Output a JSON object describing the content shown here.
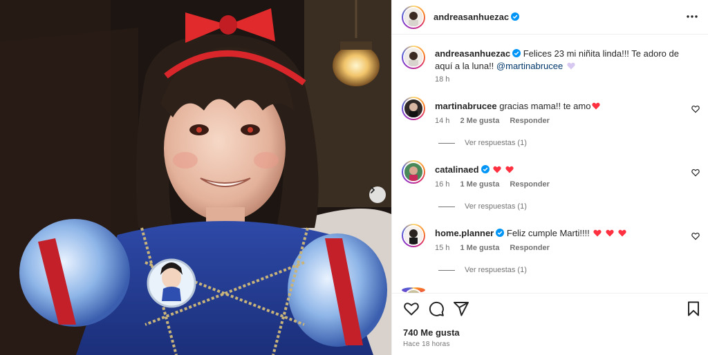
{
  "post": {
    "author": "andreasanhuezac",
    "more_icon": "more-horizontal-icon",
    "caption_user": "andreasanhuezac",
    "caption_text": "Felices 23 mi niñita linda!!! Te adoro de aquí a la luna!!",
    "caption_mention": "@martinabrucee",
    "caption_emoji": "purple-heart",
    "caption_time": "18 h",
    "likes": "740 Me gusta",
    "time_ago": "Hace 18 horas",
    "photo_next_icon": "chevron-right-icon"
  },
  "comments": [
    {
      "user": "martinabrucee",
      "verified": false,
      "text": "gracias mama!! te amo",
      "emoji": "heart",
      "time": "14 h",
      "likes": "2 Me gusta",
      "reply": "Responder",
      "view_replies": "Ver respuestas (1)"
    },
    {
      "user": "catalinaed",
      "verified": true,
      "text": "",
      "emoji": "heart heart",
      "time": "16 h",
      "likes": "1 Me gusta",
      "reply": "Responder",
      "view_replies": "Ver respuestas (1)"
    },
    {
      "user": "home.planner",
      "verified": true,
      "text": "Feliz cumple Marti!!!!",
      "emoji": "heart heart heart",
      "time": "15 h",
      "likes": "1 Me gusta",
      "reply": "Responder",
      "view_replies": "Ver respuestas (1)"
    }
  ],
  "icons": {
    "like": "heart-icon",
    "comment": "comment-icon",
    "share": "share-icon",
    "save": "bookmark-icon"
  },
  "colors": {
    "verified": "#0095f6",
    "heart": "#ff3040",
    "mention": "#00376b",
    "ring": "#d62976"
  }
}
